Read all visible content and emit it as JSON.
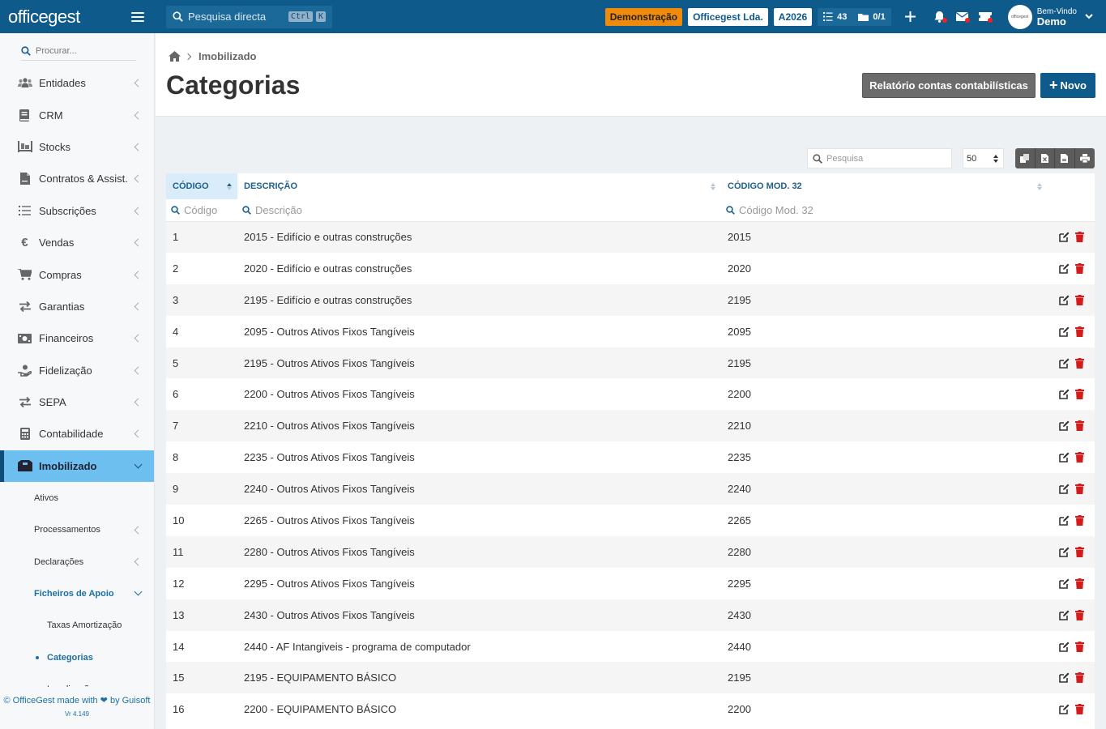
{
  "topbar": {
    "logo": "officegest",
    "search_placeholder": "Pesquisa directa",
    "kbd1": "Ctrl",
    "kbd2": "K",
    "badge_demo": "Demonstração",
    "badge_company": "Officegest Lda.",
    "badge_year": "A2026",
    "tasks_count": "43",
    "docs_count": "0/1",
    "user_greeting": "Bem-Vindo",
    "user_name": "Demo",
    "accent": "#0e5a8a"
  },
  "sidebar": {
    "search_placeholder": "Procurar...",
    "items": [
      {
        "label": "Entidades",
        "icon": "users-icon"
      },
      {
        "label": "CRM",
        "icon": "book-icon"
      },
      {
        "label": "Stocks",
        "icon": "pallet-icon"
      },
      {
        "label": "Contratos & Assist.",
        "icon": "file-contract-icon"
      },
      {
        "label": "Subscrições",
        "icon": "list-icon"
      },
      {
        "label": "Vendas",
        "icon": "euro-icon"
      },
      {
        "label": "Compras",
        "icon": "cart-icon"
      },
      {
        "label": "Garantias",
        "icon": "exchange-icon"
      },
      {
        "label": "Financeiros",
        "icon": "money-icon"
      },
      {
        "label": "Fidelização",
        "icon": "hand-holding-icon"
      },
      {
        "label": "SEPA",
        "icon": "exchange-icon"
      },
      {
        "label": "Contabilidade",
        "icon": "calculator-icon"
      }
    ],
    "active": {
      "label": "Imobilizado",
      "icon": "boxes-icon"
    },
    "subitems": [
      {
        "label": "Ativos"
      },
      {
        "label": "Processamentos"
      },
      {
        "label": "Declarações"
      }
    ],
    "support_files": "Ficheiros de Apoio",
    "support_children": [
      "Taxas Amortização",
      "Categorias",
      "Localizações"
    ],
    "footer_line": "© OfficeGest made with ❤ by Guisoft",
    "footer_version": "Vr 4.149"
  },
  "header": {
    "breadcrumb": "Imobilizado",
    "title": "Categorias",
    "report_button": "Relatório contas contabilísticas",
    "new_button": "Novo"
  },
  "tools": {
    "search_placeholder": "Pesquisa",
    "page_size": "50"
  },
  "table": {
    "columns": [
      "CÓDIGO",
      "DESCRIÇÃO",
      "CÓDIGO MOD. 32"
    ],
    "filters": [
      "Código",
      "Descrição",
      "Código Mod. 32"
    ],
    "rows": [
      {
        "codigo": "1",
        "descricao": "2015 - Edifício e outras construções",
        "mod32": "2015"
      },
      {
        "codigo": "2",
        "descricao": "2020 - Edifício e outras construções",
        "mod32": "2020"
      },
      {
        "codigo": "3",
        "descricao": "2195 - Edifício e outras construções",
        "mod32": "2195"
      },
      {
        "codigo": "4",
        "descricao": "2095 - Outros Ativos Fixos Tangíveis",
        "mod32": "2095"
      },
      {
        "codigo": "5",
        "descricao": "2195 - Outros Ativos Fixos Tangíveis",
        "mod32": "2195"
      },
      {
        "codigo": "6",
        "descricao": "2200 - Outros Ativos Fixos Tangíveis",
        "mod32": "2200"
      },
      {
        "codigo": "7",
        "descricao": "2210 - Outros Ativos Fixos Tangíveis",
        "mod32": "2210"
      },
      {
        "codigo": "8",
        "descricao": "2235 - Outros Ativos Fixos Tangíveis",
        "mod32": "2235"
      },
      {
        "codigo": "9",
        "descricao": "2240 - Outros Ativos Fixos Tangíveis",
        "mod32": "2240"
      },
      {
        "codigo": "10",
        "descricao": "2265 - Outros Ativos Fixos Tangíveis",
        "mod32": "2265"
      },
      {
        "codigo": "11",
        "descricao": "2280 - Outros Ativos Fixos Tangíveis",
        "mod32": "2280"
      },
      {
        "codigo": "12",
        "descricao": "2295 - Outros Ativos Fixos Tangíveis",
        "mod32": "2295"
      },
      {
        "codigo": "13",
        "descricao": "2430 - Outros Ativos Fixos Tangíveis",
        "mod32": "2430"
      },
      {
        "codigo": "14",
        "descricao": "2440 - AF Intangiveis - programa de computador",
        "mod32": "2440"
      },
      {
        "codigo": "15",
        "descricao": "2195 - EQUIPAMENTO BÁSICO",
        "mod32": "2195"
      },
      {
        "codigo": "16",
        "descricao": "2200 - EQUIPAMENTO BÁSICO",
        "mod32": "2200"
      }
    ],
    "delete_color": "#d31b1b"
  }
}
